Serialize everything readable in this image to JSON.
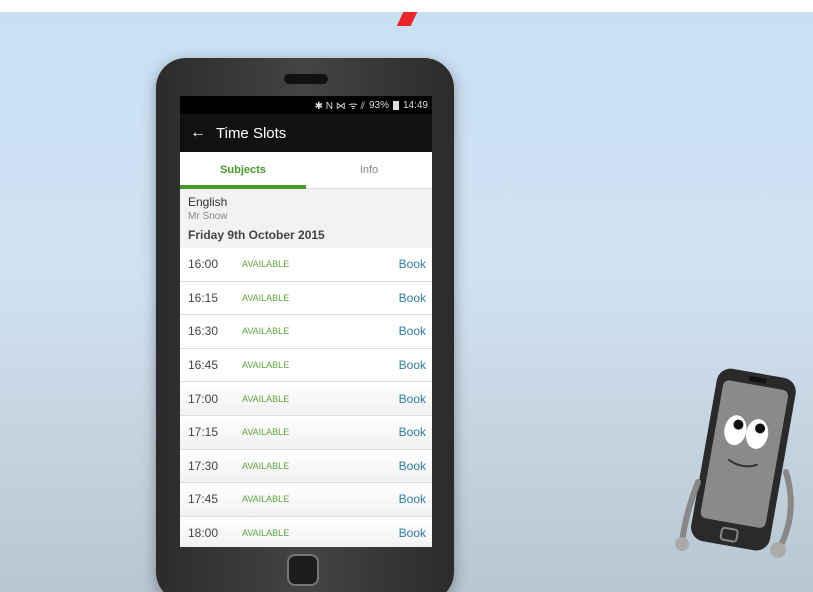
{
  "status_bar": {
    "icons": "✱ N ⋈ ᯤ ⫽",
    "battery": "93%",
    "time": "14:49"
  },
  "app_bar": {
    "back_icon": "←",
    "title": "Time Slots"
  },
  "tabs": [
    {
      "label": "Subjects"
    },
    {
      "label": "Info"
    }
  ],
  "header": {
    "subject": "English",
    "teacher": "Mr Snow",
    "date": "Friday 9th October 2015"
  },
  "slots": [
    {
      "time": "16:00",
      "status": "AVAILABLE",
      "action": "Book"
    },
    {
      "time": "16:15",
      "status": "AVAILABLE",
      "action": "Book"
    },
    {
      "time": "16:30",
      "status": "AVAILABLE",
      "action": "Book"
    },
    {
      "time": "16:45",
      "status": "AVAILABLE",
      "action": "Book"
    },
    {
      "time": "17:00",
      "status": "AVAILABLE",
      "action": "Book"
    },
    {
      "time": "17:15",
      "status": "AVAILABLE",
      "action": "Book"
    },
    {
      "time": "17:30",
      "status": "AVAILABLE",
      "action": "Book"
    },
    {
      "time": "17:45",
      "status": "AVAILABLE",
      "action": "Book"
    },
    {
      "time": "18:00",
      "status": "AVAILABLE",
      "action": "Book"
    }
  ],
  "colors": {
    "accent": "#4a9a2a",
    "status": "#5ea53c",
    "link": "#2e7fa0"
  }
}
